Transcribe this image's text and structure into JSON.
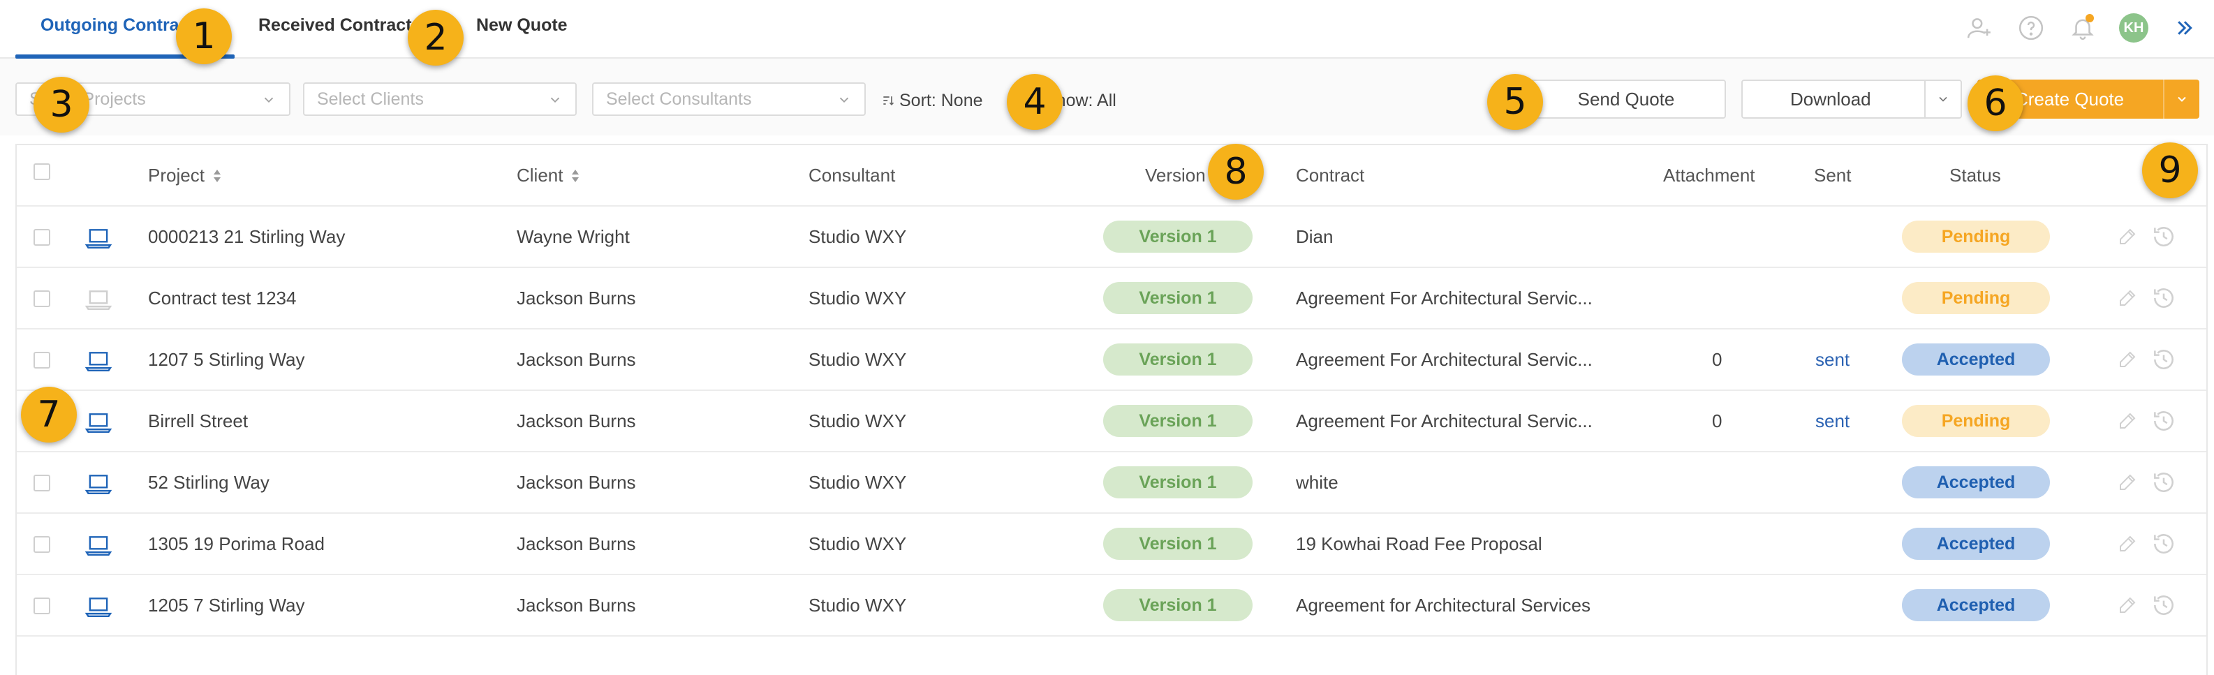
{
  "tabs": [
    {
      "label": "Outgoing Contracts",
      "active": true
    },
    {
      "label": "Received Contracts",
      "active": false
    },
    {
      "label": "New Quote",
      "active": false
    }
  ],
  "user": {
    "initials": "KH",
    "notification_dot_color": "#f5a623"
  },
  "filters": {
    "projects_placeholder": "Select Projects",
    "clients_placeholder": "Select Clients",
    "consultants_placeholder": "Select Consultants",
    "sort_label": "Sort: None",
    "show_label": "Show: All"
  },
  "actions": {
    "send_quote": "Send Quote",
    "download": "Download",
    "create_quote": "Create Quote"
  },
  "table": {
    "headers": {
      "project": "Project",
      "client": "Client",
      "consultant": "Consultant",
      "version": "Version",
      "contract": "Contract",
      "attachment": "Attachment",
      "sent": "Sent",
      "status": "Status"
    },
    "rows": [
      {
        "project": "0000213 21 Stirling Way",
        "client": "Wayne Wright",
        "consultant": "Studio WXY",
        "version": "Version 1",
        "contract": "Dian",
        "attachment": "",
        "sent": "",
        "status": "Pending",
        "device_active": true
      },
      {
        "project": "Contract test 1234",
        "client": "Jackson Burns",
        "consultant": "Studio WXY",
        "version": "Version 1",
        "contract": "Agreement For Architectural Servic...",
        "attachment": "",
        "sent": "",
        "status": "Pending",
        "device_active": false
      },
      {
        "project": "1207 5 Stirling Way",
        "client": "Jackson Burns",
        "consultant": "Studio WXY",
        "version": "Version 1",
        "contract": "Agreement For Architectural Servic...",
        "attachment": "0",
        "sent": "sent",
        "status": "Accepted",
        "device_active": true
      },
      {
        "project": "Birrell Street",
        "client": "Jackson Burns",
        "consultant": "Studio WXY",
        "version": "Version 1",
        "contract": "Agreement For Architectural Servic...",
        "attachment": "0",
        "sent": "sent",
        "status": "Pending",
        "device_active": true
      },
      {
        "project": "52 Stirling Way",
        "client": "Jackson Burns",
        "consultant": "Studio WXY",
        "version": "Version 1",
        "contract": "white",
        "attachment": "",
        "sent": "",
        "status": "Accepted",
        "device_active": true
      },
      {
        "project": "1305 19 Porima Road",
        "client": "Jackson Burns",
        "consultant": "Studio WXY",
        "version": "Version 1",
        "contract": "19 Kowhai Road Fee Proposal",
        "attachment": "",
        "sent": "",
        "status": "Accepted",
        "device_active": true
      },
      {
        "project": "1205 7 Stirling Way",
        "client": "Jackson Burns",
        "consultant": "Studio WXY",
        "version": "Version 1",
        "contract": "Agreement for Architectural Services",
        "attachment": "",
        "sent": "",
        "status": "Accepted",
        "device_active": true
      }
    ]
  },
  "annotations": [
    "1",
    "2",
    "3",
    "4",
    "5",
    "6",
    "7",
    "8",
    "9"
  ],
  "colors": {
    "accent_blue": "#1f64b8",
    "primary_orange": "#f5a623",
    "badge_yellow": "#f6b21a"
  }
}
